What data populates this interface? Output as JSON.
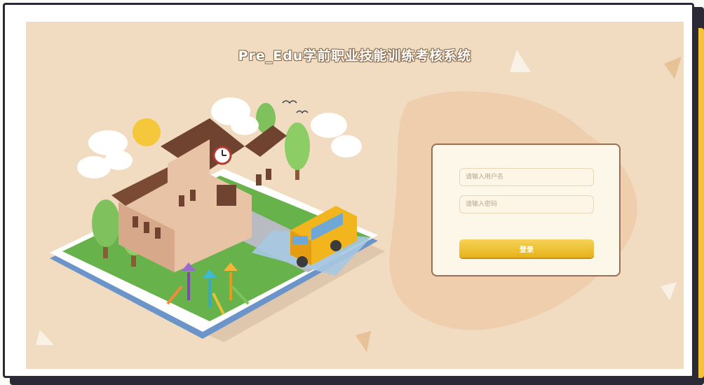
{
  "app": {
    "title": "Pre_Edu学前职业技能训练考核系统"
  },
  "login": {
    "username_placeholder": "请输入用户名",
    "username_value": "",
    "password_placeholder": "请输入密码",
    "password_value": "",
    "submit_label": "登录"
  },
  "colors": {
    "background": "#f1dcc1",
    "accent": "#f5c23a",
    "card_border": "#9a6f55",
    "button": "#e9b620"
  },
  "illustration": {
    "subject": "isometric school on open book with bus, playground, trees and clouds"
  }
}
